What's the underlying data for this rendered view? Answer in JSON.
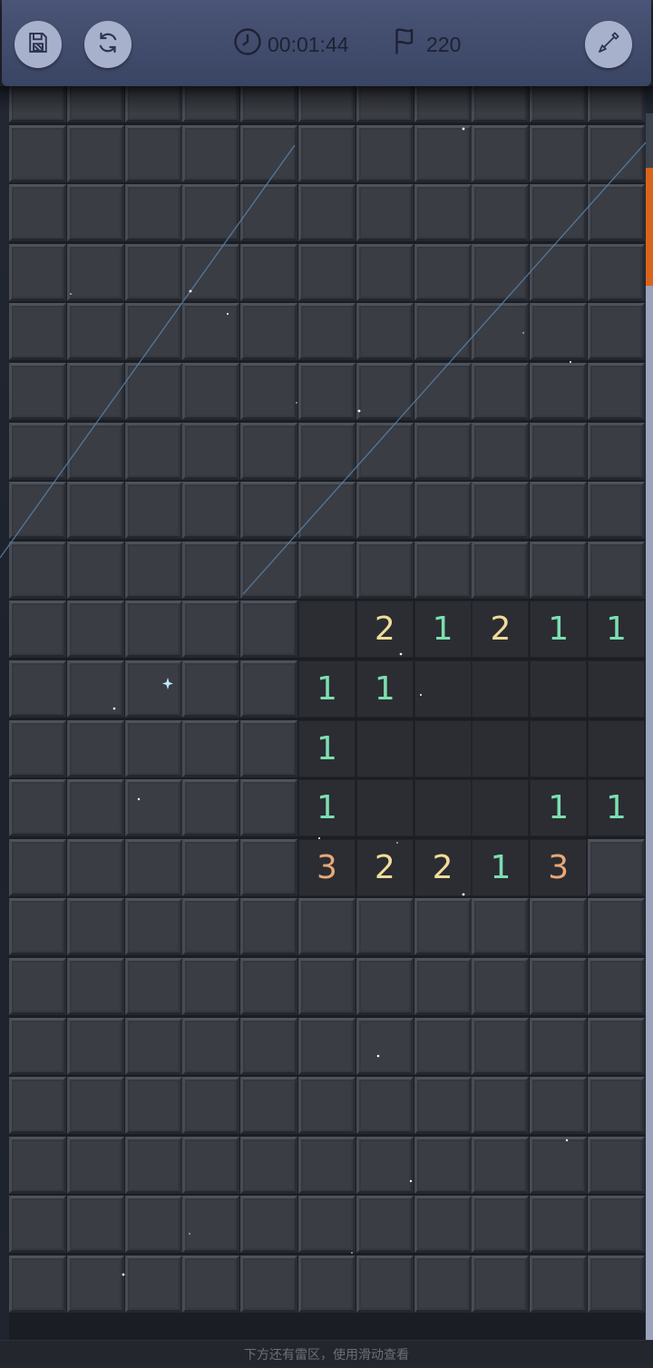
{
  "toolbar": {
    "save_icon": "floppy-disk-icon",
    "restart_icon": "restart-icon",
    "timer_icon": "clock-icon",
    "timer": "00:01:44",
    "flag_icon": "flag-icon",
    "flag_count": "220",
    "tool_icon": "shovel-icon"
  },
  "board": {
    "cols": 11,
    "rows": 21,
    "opened": [
      {
        "r": 9,
        "c": 5,
        "v": ""
      },
      {
        "r": 9,
        "c": 6,
        "v": "2"
      },
      {
        "r": 9,
        "c": 7,
        "v": "1"
      },
      {
        "r": 9,
        "c": 8,
        "v": "2"
      },
      {
        "r": 9,
        "c": 9,
        "v": "1"
      },
      {
        "r": 9,
        "c": 10,
        "v": "1"
      },
      {
        "r": 10,
        "c": 5,
        "v": "1"
      },
      {
        "r": 10,
        "c": 6,
        "v": "1"
      },
      {
        "r": 10,
        "c": 7,
        "v": ""
      },
      {
        "r": 10,
        "c": 8,
        "v": ""
      },
      {
        "r": 10,
        "c": 9,
        "v": ""
      },
      {
        "r": 10,
        "c": 10,
        "v": ""
      },
      {
        "r": 11,
        "c": 5,
        "v": "1"
      },
      {
        "r": 11,
        "c": 6,
        "v": ""
      },
      {
        "r": 11,
        "c": 7,
        "v": ""
      },
      {
        "r": 11,
        "c": 8,
        "v": ""
      },
      {
        "r": 11,
        "c": 9,
        "v": ""
      },
      {
        "r": 11,
        "c": 10,
        "v": ""
      },
      {
        "r": 12,
        "c": 5,
        "v": "1"
      },
      {
        "r": 12,
        "c": 6,
        "v": ""
      },
      {
        "r": 12,
        "c": 7,
        "v": ""
      },
      {
        "r": 12,
        "c": 8,
        "v": ""
      },
      {
        "r": 12,
        "c": 9,
        "v": "1"
      },
      {
        "r": 12,
        "c": 10,
        "v": "1"
      },
      {
        "r": 13,
        "c": 5,
        "v": "3"
      },
      {
        "r": 13,
        "c": 6,
        "v": "2"
      },
      {
        "r": 13,
        "c": 7,
        "v": "2"
      },
      {
        "r": 13,
        "c": 8,
        "v": "1"
      },
      {
        "r": 13,
        "c": 9,
        "v": "3"
      }
    ],
    "number_colors": {
      "1": "#7ddfb0",
      "2": "#f0dc98",
      "3": "#e9a877"
    }
  },
  "hint": "下方还有雷区，使用滑动查看",
  "accent_color": "#d9651c"
}
